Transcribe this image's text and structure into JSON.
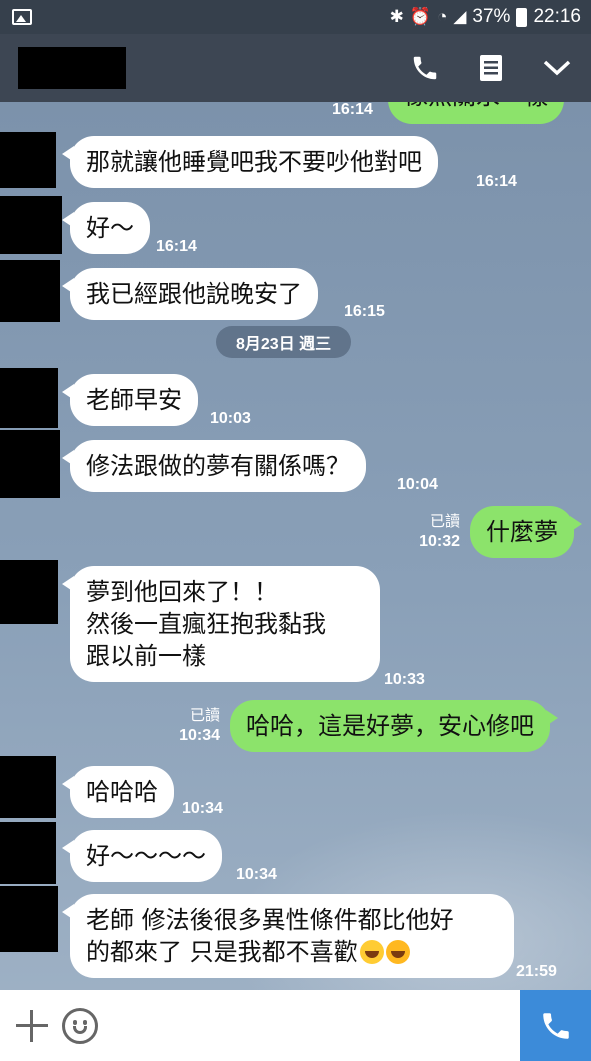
{
  "status_bar": {
    "battery": "37%",
    "time": "22:16"
  },
  "header": {
    "contact_name": ""
  },
  "messages": [
    {
      "side": "out",
      "text": "像無關永一樣",
      "time": "16:14"
    },
    {
      "side": "in",
      "text": "那就讓他睡覺吧我不要吵他對吧",
      "time": "16:14"
    },
    {
      "side": "in",
      "text": "好～",
      "time": "16:14"
    },
    {
      "side": "in",
      "text": "我已經跟他說晚安了",
      "time": "16:15"
    },
    {
      "side": "date",
      "text": "8月23日 週三"
    },
    {
      "side": "in",
      "text": "老師早安",
      "time": "10:03"
    },
    {
      "side": "in",
      "text": "修法跟做的夢有關係嗎？",
      "time": "10:04"
    },
    {
      "side": "out",
      "text": "什麼夢",
      "read": "已讀",
      "time": "10:32"
    },
    {
      "side": "in",
      "lines": [
        "夢到他回來了！！",
        "然後一直瘋狂抱我黏我",
        "跟以前一樣"
      ],
      "time": "10:33"
    },
    {
      "side": "out",
      "text": "哈哈，這是好夢，安心修吧",
      "read": "已讀",
      "time": "10:34"
    },
    {
      "side": "in",
      "text": "哈哈哈",
      "time": "10:34"
    },
    {
      "side": "in",
      "text": "好～～～～",
      "time": "10:34"
    },
    {
      "side": "in",
      "lines": [
        "老師 修法後很多異性條件都比他好",
        "的都來了 只是我都不喜歡"
      ],
      "emojis": [
        "tears-of-joy-emoji",
        "rolling-laughing-emoji"
      ],
      "time": "21:59"
    }
  ],
  "colors": {
    "out_bubble": "#8ce36b",
    "in_bubble": "#ffffff",
    "header": "#3d4653",
    "send": "#3c8bd9"
  }
}
